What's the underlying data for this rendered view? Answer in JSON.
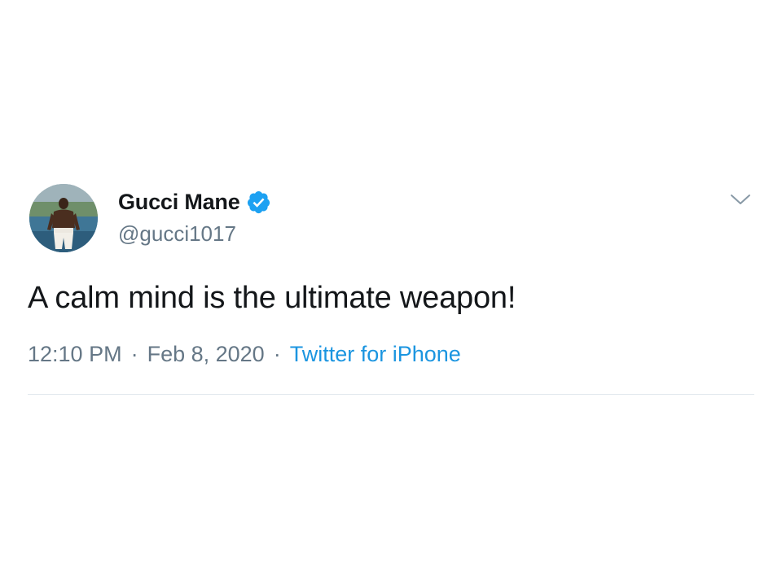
{
  "tweet": {
    "display_name": "Gucci Mane",
    "verified": true,
    "handle": "@gucci1017",
    "text": "A calm mind is the ultimate weapon!",
    "time": "12:10 PM",
    "date": "Feb 8, 2020",
    "separator": "·",
    "source": "Twitter for iPhone"
  },
  "icons": {
    "verified": "verified-badge-icon",
    "menu": "chevron-down-icon"
  },
  "colors": {
    "text_primary": "#14171a",
    "text_secondary": "#657786",
    "link": "#1b95e0",
    "verified": "#1da1f2",
    "divider": "#e1e8ed"
  }
}
